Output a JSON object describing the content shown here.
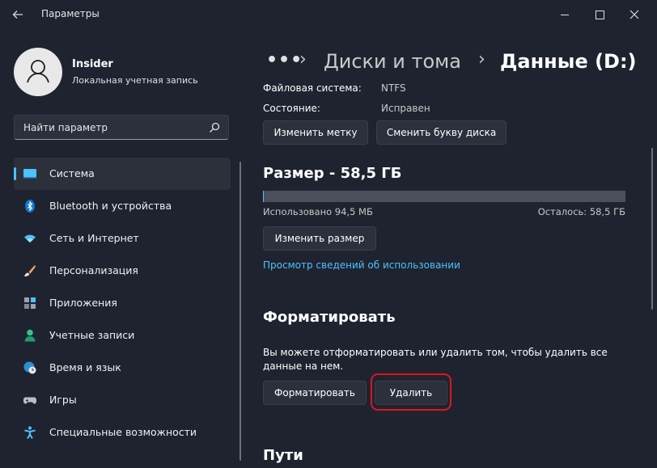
{
  "window": {
    "title": "Параметры"
  },
  "user": {
    "name": "Insider",
    "subtitle": "Локальная учетная запись"
  },
  "search": {
    "placeholder": "Найти параметр"
  },
  "sidebar": {
    "items": [
      {
        "label": "Система",
        "icon": "monitor-icon",
        "active": true
      },
      {
        "label": "Bluetooth и устройства",
        "icon": "bluetooth-icon"
      },
      {
        "label": "Сеть и Интернет",
        "icon": "wifi-icon"
      },
      {
        "label": "Персонализация",
        "icon": "brush-icon"
      },
      {
        "label": "Приложения",
        "icon": "apps-icon"
      },
      {
        "label": "Учетные записи",
        "icon": "person-icon"
      },
      {
        "label": "Время и язык",
        "icon": "globe-clock-icon"
      },
      {
        "label": "Игры",
        "icon": "gamepad-icon"
      },
      {
        "label": "Специальные возможности",
        "icon": "accessibility-icon"
      }
    ]
  },
  "breadcrumb": {
    "dots": "•••",
    "sep": "›",
    "parent": "Диски и тома",
    "current": "Данные (D:)"
  },
  "properties": {
    "filesystem_label": "Файловая система:",
    "filesystem_value": "NTFS",
    "status_label": "Состояние:",
    "status_value": "Исправен"
  },
  "buttons": {
    "change_label": "Изменить метку",
    "change_letter": "Сменить букву диска",
    "resize": "Изменить размер",
    "format": "Форматировать",
    "delete": "Удалить"
  },
  "size": {
    "heading": "Размер - 58,5 ГБ",
    "used": "Использовано 94,5 МБ",
    "free": "Осталось: 58,5 ГБ",
    "used_fraction": 0.0016
  },
  "usage_link": "Просмотр сведений об использовании",
  "format_section": {
    "heading": "Форматировать",
    "description": "Вы можете отформатировать или удалить том, чтобы удалить все данные на нем."
  },
  "paths_section": {
    "heading": "Пути"
  },
  "colors": {
    "accent": "#4cc2ff",
    "highlight": "#e0141c",
    "background": "#1f2330"
  }
}
